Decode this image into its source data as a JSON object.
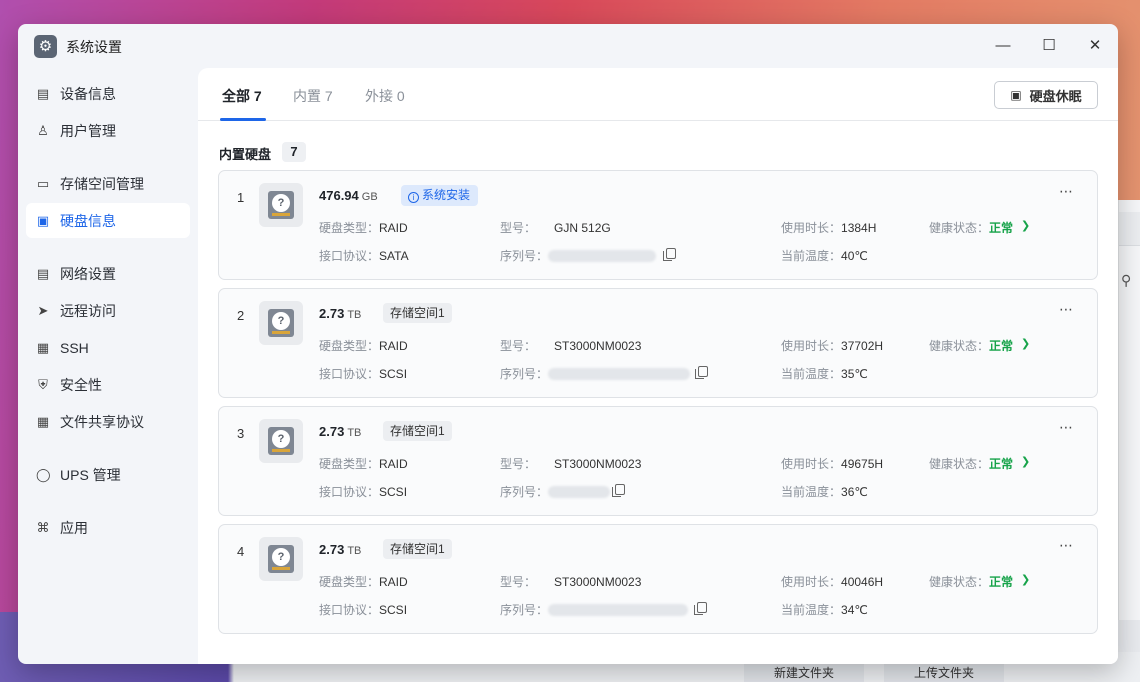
{
  "window": {
    "title": "系统设置",
    "app_icon": "gear-icon"
  },
  "sidebar": {
    "items": [
      {
        "label": "设备信息",
        "icon": "monitor-icon"
      },
      {
        "label": "用户管理",
        "icon": "user-icon"
      },
      {
        "label": "存储空间管理",
        "icon": "storage-icon"
      },
      {
        "label": "硬盘信息",
        "icon": "disk-icon",
        "active": true
      },
      {
        "label": "网络设置",
        "icon": "network-icon"
      },
      {
        "label": "远程访问",
        "icon": "send-icon"
      },
      {
        "label": "SSH",
        "icon": "terminal-icon"
      },
      {
        "label": "安全性",
        "icon": "shield-check-icon"
      },
      {
        "label": "文件共享协议",
        "icon": "file-icon"
      },
      {
        "label": "UPS 管理",
        "icon": "shield-icon"
      },
      {
        "label": "应用",
        "icon": "apps-icon"
      }
    ]
  },
  "tabs": [
    {
      "label": "全部 7",
      "active": true
    },
    {
      "label": "内置 7"
    },
    {
      "label": "外接 0"
    }
  ],
  "sleep_button": "硬盘休眠",
  "section": {
    "title": "内置硬盘",
    "count": "7"
  },
  "labels": {
    "type": "硬盘类型：",
    "iface": "接口协议：",
    "model": "型号：",
    "serial": "序列号：",
    "hours": "使用时长：",
    "temp": "当前温度：",
    "health": "健康状态：",
    "system_badge": "系统安装"
  },
  "disks": [
    {
      "index": "1",
      "capacity": "476.94",
      "unit": "GB",
      "type": "RAID",
      "iface": "SATA",
      "model": "GJN 512G",
      "hours": "1384H",
      "temp": "40℃",
      "health": "正常"
    },
    {
      "index": "2",
      "capacity": "2.73",
      "unit": "TB",
      "pool": "存储空间1",
      "type": "RAID",
      "iface": "SCSI",
      "model": "ST3000NM0023",
      "hours": "37702H",
      "temp": "35℃",
      "health": "正常"
    },
    {
      "index": "3",
      "capacity": "2.73",
      "unit": "TB",
      "pool": "存储空间1",
      "type": "RAID",
      "iface": "SCSI",
      "model": "ST3000NM0023",
      "hours": "49675H",
      "temp": "36℃",
      "health": "正常"
    },
    {
      "index": "4",
      "capacity": "2.73",
      "unit": "TB",
      "pool": "存储空间1",
      "type": "RAID",
      "iface": "SCSI",
      "model": "ST3000NM0023",
      "hours": "40046H",
      "temp": "34℃",
      "health": "正常"
    }
  ],
  "background": {
    "btn_new_folder": "新建文件夹",
    "btn_upload_folder": "上传文件夹"
  }
}
